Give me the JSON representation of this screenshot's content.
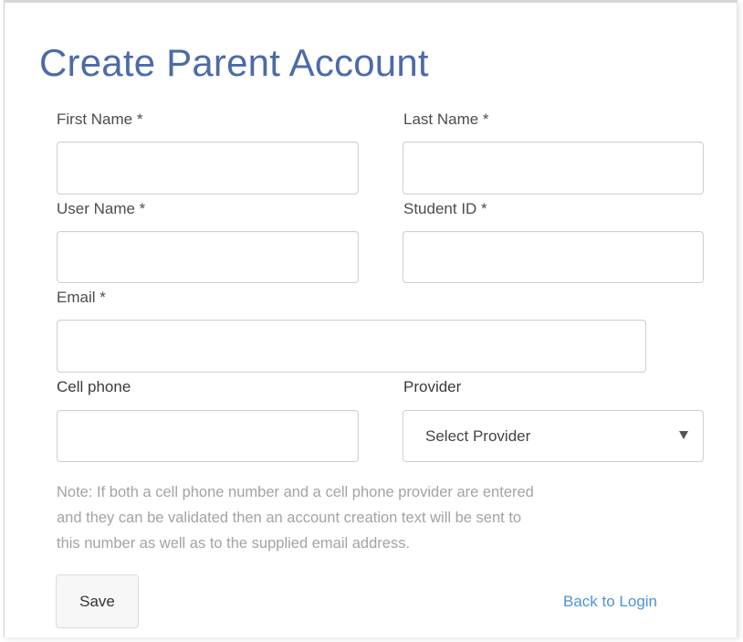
{
  "form": {
    "title": "Create Parent Account",
    "first_name": {
      "label": "First Name *",
      "value": ""
    },
    "last_name": {
      "label": "Last Name *",
      "value": ""
    },
    "user_name": {
      "label": "User Name *",
      "value": ""
    },
    "student_id": {
      "label": "Student ID *",
      "value": ""
    },
    "email": {
      "label": "Email *",
      "value": ""
    },
    "cell_phone": {
      "label": "Cell phone",
      "value": ""
    },
    "provider": {
      "label": "Provider",
      "selected": "Select Provider"
    },
    "note_lines": [
      "Note: If both a cell phone number and a cell phone provider are entered",
      "and they can be validated then an account creation text will be sent to",
      "this number as well as to the supplied email address."
    ],
    "save_label": "Save",
    "back_label": "Back to Login"
  },
  "colors": {
    "title": "#4d6aa8",
    "link": "#4d93d6",
    "note": "#a3a3a3"
  },
  "icons": {
    "provider_dropdown": "caret-down-icon"
  }
}
